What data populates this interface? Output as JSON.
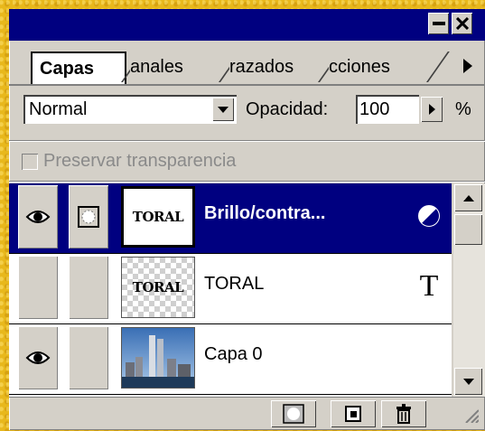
{
  "window": {
    "minimize_icon": "minimize-icon",
    "close_icon": "close-icon"
  },
  "tabs": [
    {
      "label": "Capas",
      "active": true
    },
    {
      "label": "anales",
      "active": false
    },
    {
      "label": "razados",
      "active": false
    },
    {
      "label": "cciones",
      "active": false
    }
  ],
  "toolbar": {
    "blend_mode": "Normal",
    "opacity_label": "Opacidad:",
    "opacity_value": "100",
    "opacity_unit": "%"
  },
  "preserve_transparency": {
    "label": "Preservar transparencia",
    "checked": false,
    "enabled": false
  },
  "layers": [
    {
      "name": "Brillo/contra...",
      "thumb_text": "TORAL",
      "visible": true,
      "selected": true,
      "kind_icon": "adjustment-layer-icon"
    },
    {
      "name": "TORAL",
      "thumb_text": "TORAL",
      "visible": false,
      "selected": false,
      "kind_icon": "text-layer-icon",
      "kind_glyph": "T"
    },
    {
      "name": "Capa 0",
      "visible": true,
      "selected": false,
      "kind_icon": "image-thumbnail"
    }
  ],
  "bottom_buttons": [
    "mask-icon",
    "new-layer-icon",
    "trash-icon"
  ],
  "colors": {
    "title_bar": "#000080",
    "selection": "#000080",
    "panel": "#d4d0c8",
    "background": "#e8b81c"
  }
}
